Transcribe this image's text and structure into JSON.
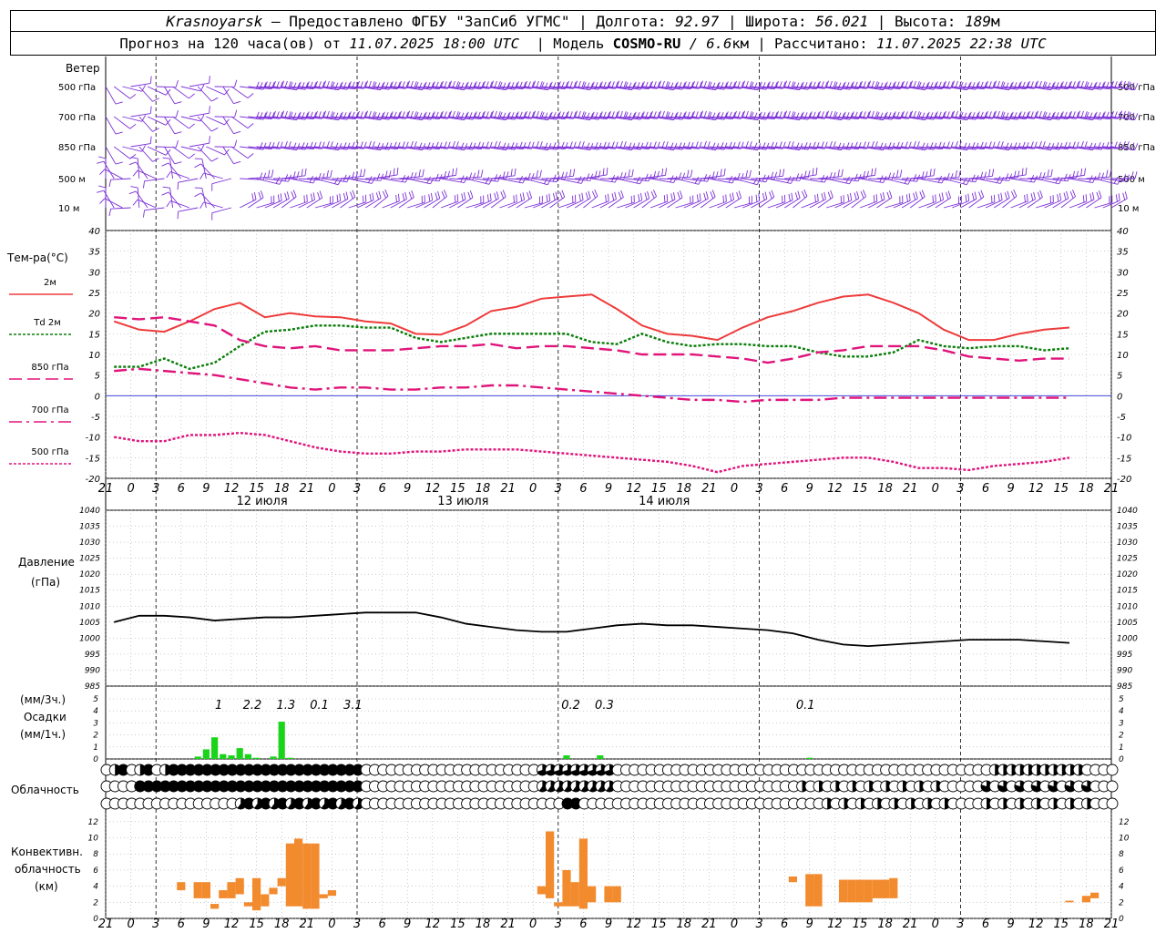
{
  "header": {
    "station": "Krasnoyarsk",
    "provider": "— Предоставлено ФГБУ \"ЗапСиб УГМС\" |",
    "lon_label": "Долгота:",
    "lon_value": "92.97",
    "lat_label": "| Широта:",
    "lat_value": "56.021",
    "alt_label": "| Высота:",
    "alt_value": "189",
    "alt_unit": "м",
    "forecast_label": "Прогноз на 120 часа(ов) от",
    "forecast_from": "11.07.2025 18:00 UTC",
    "model_label": "| Модель",
    "model_name": "COSMO-RU",
    "model_res": "/ 6.6",
    "model_res_unit": "км",
    "calc_label": "| Рассчитано:",
    "calc_time": "11.07.2025 22:38 UTC"
  },
  "chart_data": [
    {
      "type": "wind-barbs",
      "title": "Ветер",
      "levels": [
        "500 гПа",
        "700 гПа",
        "850 гПа",
        "500 м",
        "10  м"
      ],
      "note": "Wind barbs for each level, every hour of the 120-hour forecast"
    },
    {
      "type": "line",
      "ylabel": "Тем-ра(°С)",
      "ylim": [
        -20,
        40
      ],
      "yticks": [
        -20,
        -15,
        -10,
        -5,
        0,
        5,
        10,
        15,
        20,
        25,
        30,
        35,
        40
      ],
      "x_hours": [
        0,
        3,
        6,
        9,
        12,
        15,
        18,
        21,
        24,
        27,
        30,
        33,
        36,
        39,
        42,
        45,
        48,
        51,
        54,
        57,
        60,
        63,
        66,
        69,
        72,
        75,
        78,
        81,
        84,
        87,
        90,
        93,
        96,
        99,
        102,
        105,
        108,
        111,
        114,
        117,
        120
      ],
      "series": [
        {
          "name": "2м",
          "color": "#ee3b3b",
          "style": "solid",
          "values": [
            18,
            16,
            15.5,
            18,
            21,
            22.5,
            19,
            20,
            19.2,
            19,
            18,
            17.5,
            15,
            14.8,
            17,
            20.5,
            21.5,
            23.5,
            24,
            24.5,
            21,
            17,
            15,
            14.5,
            13.5,
            16.5,
            19,
            20.5,
            22.5,
            24,
            24.5,
            22.5,
            20,
            16,
            13.5,
            13.5,
            15,
            16,
            16.5
          ]
        },
        {
          "name": "Td  2м",
          "color": "#0a7d0a",
          "style": "dotted",
          "values": [
            7,
            7,
            9,
            6.5,
            8,
            12,
            15.5,
            16,
            17,
            17,
            16.5,
            16.5,
            14,
            13,
            14,
            15,
            15,
            15,
            15,
            13,
            12.5,
            15,
            13,
            12,
            12.5,
            12.5,
            12,
            12,
            10.5,
            9.5,
            9.5,
            10.5,
            13.5,
            12,
            11.5,
            12,
            12,
            11,
            11.5
          ]
        },
        {
          "name": "850 гПа",
          "color": "#e0147b",
          "style": "dashed",
          "values": [
            19,
            18.5,
            19,
            18,
            17,
            13.5,
            12,
            11.5,
            12,
            11,
            11,
            11,
            11.5,
            12,
            12,
            12.5,
            11.5,
            12,
            12,
            11.5,
            11,
            10,
            10,
            10,
            9.5,
            9,
            8,
            9,
            10.5,
            11,
            12,
            12,
            12,
            11,
            9.5,
            9,
            8.5,
            9,
            9
          ]
        },
        {
          "name": "700 гПа",
          "color": "#e0147b",
          "style": "dashdot",
          "values": [
            6,
            6.5,
            6,
            5.5,
            5,
            4,
            3,
            2,
            1.5,
            2,
            2,
            1.5,
            1.5,
            2,
            2,
            2.5,
            2.5,
            2,
            1.5,
            1,
            0.5,
            0,
            -0.5,
            -1,
            -1,
            -1.5,
            -1,
            -1,
            -1,
            -0.5,
            -0.5,
            -0.5,
            -0.5,
            -0.5,
            -0.5,
            -0.5,
            -0.5,
            -0.5,
            -0.5
          ]
        },
        {
          "name": "500 гПа",
          "color": "#e0147b",
          "style": "dotted",
          "values": [
            -10,
            -11,
            -11,
            -9.5,
            -9.5,
            -9,
            -9.5,
            -11,
            -12.5,
            -13.5,
            -14,
            -14,
            -13.5,
            -13.5,
            -13,
            -13,
            -13,
            -13.5,
            -14,
            -14.5,
            -15,
            -15.5,
            -16,
            -17,
            -18.5,
            -17,
            -16.5,
            -16,
            -15.5,
            -15,
            -15,
            -16,
            -17.5,
            -17.5,
            -18,
            -17,
            -16.5,
            -16,
            -15
          ]
        }
      ],
      "x_tick_labels": [
        "18",
        "21",
        "0",
        "3",
        "6",
        "9",
        "12",
        "15",
        "18",
        "21",
        "0",
        "3",
        "6",
        "9",
        "12",
        "15",
        "18",
        "21",
        "0",
        "3",
        "6",
        "9",
        "12",
        "15",
        "18",
        "21",
        "0",
        "3",
        "6",
        "9",
        "12",
        "15",
        "18",
        "21",
        "0",
        "3",
        "6",
        "9",
        "12",
        "15",
        "18",
        "21",
        "0"
      ],
      "day_labels": [
        "12 июля",
        "13 июля",
        "14 июля"
      ]
    },
    {
      "type": "line",
      "ylabel": "Давление",
      "ylabel2": "(гПа)",
      "ylim": [
        985,
        1040
      ],
      "yticks": [
        985,
        990,
        995,
        1000,
        1005,
        1010,
        1015,
        1020,
        1025,
        1030,
        1035,
        1040
      ],
      "series": [
        {
          "name": "pressure",
          "color": "#000000",
          "values": [
            1005,
            1007,
            1007,
            1006.5,
            1005.5,
            1006,
            1006.5,
            1006.5,
            1007,
            1007.5,
            1008,
            1008,
            1008,
            1006.5,
            1004.5,
            1003.5,
            1002.5,
            1002,
            1002,
            1003,
            1004,
            1004.5,
            1004,
            1004,
            1003.5,
            1003,
            1002.5,
            1001.5,
            999.5,
            998,
            997.5,
            998,
            998.5,
            999,
            999.5,
            999.5,
            999.5,
            999,
            998.5
          ]
        }
      ]
    },
    {
      "type": "bar",
      "ylabel": "(мм/3ч.)",
      "ylabel2": "Осадки",
      "ylabel3": "(мм/1ч.)",
      "ylim": [
        0,
        5
      ],
      "yticks": [
        0,
        1,
        2,
        3,
        4,
        5
      ],
      "color": "#1ad41a",
      "totals_3h": [
        {
          "hour": 13.5,
          "label": "1"
        },
        {
          "hour": 17.5,
          "label": "2.2"
        },
        {
          "hour": 21.5,
          "label": "1.3"
        },
        {
          "hour": 25.5,
          "label": "0.1"
        },
        {
          "hour": 29.5,
          "label": "3.1"
        },
        {
          "hour": 55.5,
          "label": "0.2"
        },
        {
          "hour": 59.5,
          "label": "0.3"
        },
        {
          "hour": 83.5,
          "label": "0.1"
        }
      ],
      "hourly": [
        {
          "hour": 11,
          "value": 0.2
        },
        {
          "hour": 12,
          "value": 0.8
        },
        {
          "hour": 13,
          "value": 1.8
        },
        {
          "hour": 14,
          "value": 0.4
        },
        {
          "hour": 15,
          "value": 0.3
        },
        {
          "hour": 16,
          "value": 0.9
        },
        {
          "hour": 17,
          "value": 0.4
        },
        {
          "hour": 18,
          "value": 0.1
        },
        {
          "hour": 20,
          "value": 0.2
        },
        {
          "hour": 21,
          "value": 3.1
        },
        {
          "hour": 22,
          "value": 0.1
        },
        {
          "hour": 55,
          "value": 0.3
        },
        {
          "hour": 59,
          "value": 0.3
        },
        {
          "hour": 84,
          "value": 0.1
        }
      ]
    },
    {
      "type": "cloud-symbols",
      "ylabel": "Облачность",
      "rows": 3,
      "note": "Per-hour cloud cover symbols (empty circle = clear, filled = overcast)"
    },
    {
      "type": "bar",
      "ylabel": "Конвективн.",
      "ylabel2": "облачность",
      "ylabel3": "(км)",
      "ylim": [
        0,
        13
      ],
      "yticks": [
        0,
        2,
        4,
        6,
        8,
        10,
        12
      ],
      "color": "#f28a2e",
      "note": "Convective cloud base–top heights per hour",
      "bars": [
        {
          "hour": 9,
          "base": 3.5,
          "top": 4.5
        },
        {
          "hour": 11,
          "base": 2.5,
          "top": 4.5
        },
        {
          "hour": 12,
          "base": 2.5,
          "top": 4.5
        },
        {
          "hour": 13,
          "base": 1.2,
          "top": 1.8
        },
        {
          "hour": 14,
          "base": 2.5,
          "top": 3.5
        },
        {
          "hour": 15,
          "base": 2.5,
          "top": 4.5
        },
        {
          "hour": 16,
          "base": 3,
          "top": 5
        },
        {
          "hour": 17,
          "base": 1.5,
          "top": 2
        },
        {
          "hour": 18,
          "base": 1,
          "top": 5
        },
        {
          "hour": 19,
          "base": 1.5,
          "top": 3
        },
        {
          "hour": 20,
          "base": 3,
          "top": 3.8
        },
        {
          "hour": 21,
          "base": 4,
          "top": 5
        },
        {
          "hour": 22,
          "base": 1.5,
          "top": 9.3
        },
        {
          "hour": 23,
          "base": 1.5,
          "top": 9.9
        },
        {
          "hour": 24,
          "base": 1.2,
          "top": 9.3
        },
        {
          "hour": 25,
          "base": 1.2,
          "top": 9.3
        },
        {
          "hour": 26,
          "base": 2.5,
          "top": 3
        },
        {
          "hour": 27,
          "base": 2.8,
          "top": 3.5
        },
        {
          "hour": 52,
          "base": 3,
          "top": 4
        },
        {
          "hour": 53,
          "base": 2.5,
          "top": 10.8
        },
        {
          "hour": 54,
          "base": 1.5,
          "top": 2
        },
        {
          "hour": 55,
          "base": 1.5,
          "top": 6
        },
        {
          "hour": 56,
          "base": 1.5,
          "top": 4.5
        },
        {
          "hour": 57,
          "base": 1.2,
          "top": 9.9
        },
        {
          "hour": 58,
          "base": 2,
          "top": 4
        },
        {
          "hour": 60,
          "base": 2,
          "top": 4
        },
        {
          "hour": 61,
          "base": 2,
          "top": 4
        },
        {
          "hour": 82,
          "base": 4.5,
          "top": 5.2
        },
        {
          "hour": 84,
          "base": 1.5,
          "top": 5.5
        },
        {
          "hour": 85,
          "base": 1.5,
          "top": 5.5
        },
        {
          "hour": 88,
          "base": 2,
          "top": 4.8
        },
        {
          "hour": 89,
          "base": 2,
          "top": 4.8
        },
        {
          "hour": 90,
          "base": 2,
          "top": 4.8
        },
        {
          "hour": 91,
          "base": 2,
          "top": 4.8
        },
        {
          "hour": 92,
          "base": 2.5,
          "top": 4.8
        },
        {
          "hour": 93,
          "base": 2.5,
          "top": 4.8
        },
        {
          "hour": 94,
          "base": 2.5,
          "top": 5
        },
        {
          "hour": 115,
          "base": 2,
          "top": 2.2
        },
        {
          "hour": 117,
          "base": 2,
          "top": 2.8
        },
        {
          "hour": 118,
          "base": 2.5,
          "top": 3.2
        }
      ]
    }
  ],
  "colors": {
    "wind": "#7b2fd6",
    "grid": "#999999",
    "zero_line": "#2a2ad6"
  }
}
